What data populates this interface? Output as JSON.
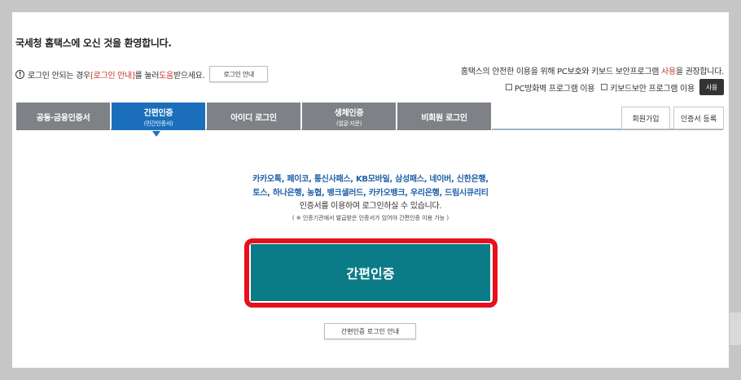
{
  "header": {
    "welcome": "국세청 홈택스에 오신 것을 환영합니다."
  },
  "help": {
    "icon": "info-icon",
    "text_before": "로그인 안되는 경우 ",
    "highlight_1": "[로그인 안내]",
    "text_middle": "를 눌러 ",
    "highlight_2": "도움",
    "text_after": "받으세요.",
    "button_label": "로그인 안내"
  },
  "security": {
    "notice_before": "홈택스의 안전한 이용을 위해 PC보호와 키보드 보안프로그램 ",
    "notice_highlight": "사용",
    "notice_after": "을 권장합니다.",
    "option_firewall": "PC방화벽 프로그램 이용",
    "option_keyboard": "키보드보안 프로그램 이용",
    "use_button": "사용"
  },
  "tabs": [
    {
      "label": "공동·금융인증서",
      "sub": ""
    },
    {
      "label": "간편인증",
      "sub": "(민간인증서)"
    },
    {
      "label": "아이디 로그인",
      "sub": ""
    },
    {
      "label": "생체인증",
      "sub": "(얼굴·지문)"
    },
    {
      "label": "비회원 로그인",
      "sub": ""
    }
  ],
  "tab_actions": {
    "signup": "회원가입",
    "cert_register": "인증서 등록"
  },
  "content": {
    "providers_line1": "카카오톡, 페이코, 통신사패스, KB모바일, 삼성패스, 네이버, 신한은행,",
    "providers_line2": "토스, 하나은행, 농협, 뱅크샐러드, 카카오뱅크, 우리은행, 드림시큐리티",
    "description": "인증서를 이용하여 로그인하실 수 있습니다.",
    "note": "( ※ 인증기관에서 발급받은 인증서가 있어야 간편인증 이용 가능 )",
    "main_button": "간편인증",
    "guide_button": "간편인증 로그인 안내"
  },
  "colors": {
    "active_tab": "#1b6fba",
    "inactive_tab": "#7e8286",
    "main_button": "#0b7c87",
    "highlight_frame": "#e8101c",
    "provider_text": "#1f5fa8"
  }
}
